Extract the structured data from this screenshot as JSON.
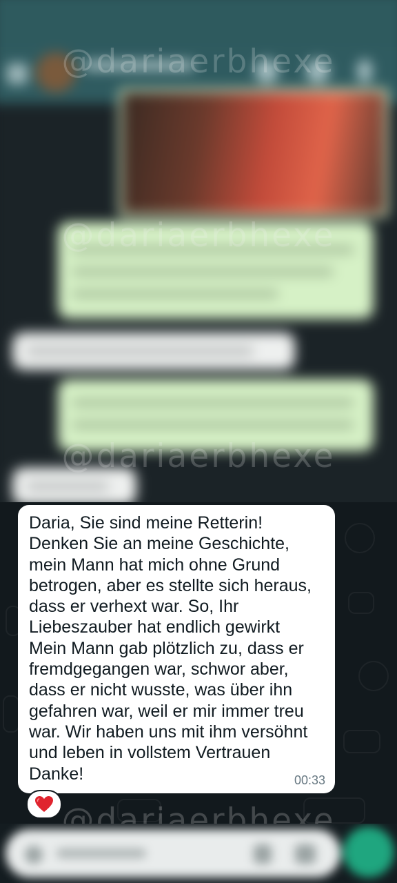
{
  "watermark": {
    "text": "@dariaerbhexe"
  },
  "message": {
    "text": "Daria, Sie sind meine Retterin!\nDenken Sie an meine Geschichte,\nmein Mann hat mich ohne Grund\nbetrogen, aber es stellte sich heraus,\ndass er verhext war. So, Ihr\nLiebeszauber hat endlich gewirkt\nMein Mann gab plötzlich zu, dass er\nfremdgegangen war, schwor aber,\ndass er nicht wusste, was über ihn\ngefahren war, weil er mir immer treu\nwar. Wir haben uns mit ihm versöhnt\nund leben in vollstem Vertrauen\nDanke!",
    "time": "00:33",
    "reaction": "heart-icon"
  },
  "colors": {
    "bubble_incoming": "#ffffff",
    "bubble_outgoing": "#d6f1c6",
    "header": "#2f5b60",
    "send_button": "#1fa67f",
    "reaction_heart": "#e0242e"
  }
}
